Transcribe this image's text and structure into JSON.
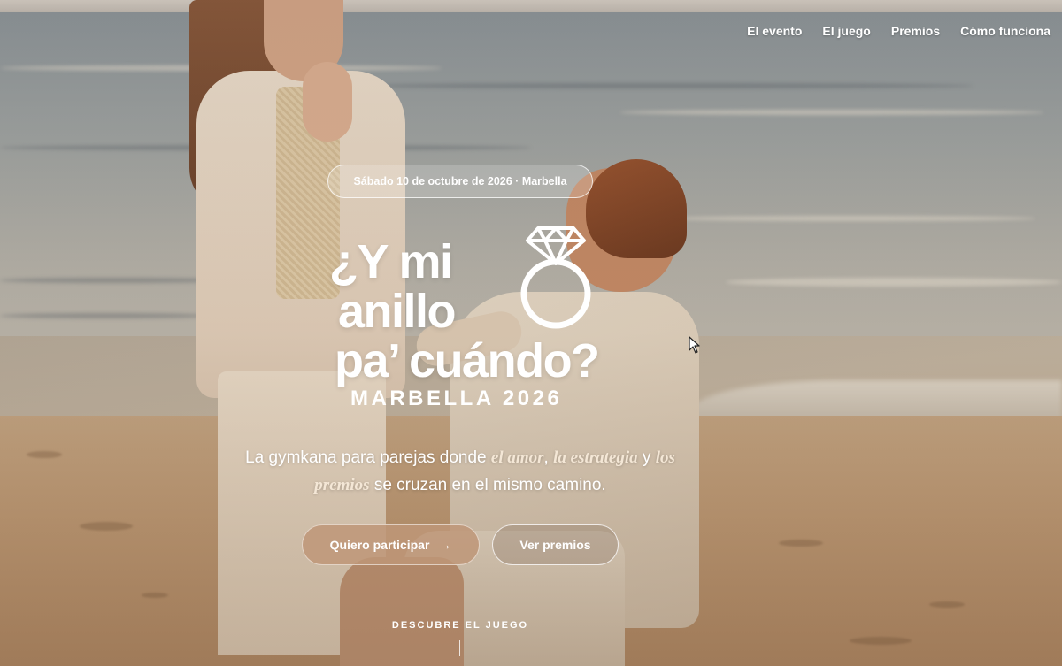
{
  "nav": {
    "items": [
      "El evento",
      "El juego",
      "Premios",
      "Cómo funciona"
    ]
  },
  "hero": {
    "date_pill": "Sábado 10 de octubre de 2026 · Marbella",
    "title_lines": [
      "¿Y mi",
      "anillo",
      "pa’ cuándo?"
    ],
    "subtitle": "MARBELLA 2026",
    "tagline": {
      "part1": "La gymkana para parejas donde ",
      "em1": "el amor",
      "sep1": ", ",
      "em2": "la estrategia",
      "sep2": " y ",
      "em3": "los premios",
      "part2": " se cruzan en el mismo camino."
    },
    "primary_button": "Quiero participar",
    "secondary_button": "Ver premios",
    "scroll_hint": "DESCUBRE EL JUEGO"
  },
  "icons": {
    "logo": "diamond-ring-icon",
    "button_arrow": "arrow-right-icon",
    "cursor": "mouse-cursor-icon"
  },
  "colors": {
    "primary_button_bg": "#be9678",
    "emphasis_text": "#f4e7d6"
  }
}
